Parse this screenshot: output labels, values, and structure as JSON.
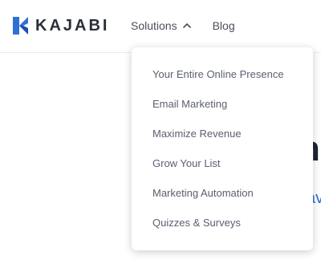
{
  "header": {
    "logo_text": "KAJABI",
    "nav": {
      "solutions_label": "Solutions",
      "blog_label": "Blog"
    }
  },
  "dropdown": {
    "items": [
      {
        "label": "Your Entire Online Presence"
      },
      {
        "label": "Email Marketing"
      },
      {
        "label": "Maximize Revenue"
      },
      {
        "label": "Grow Your List"
      },
      {
        "label": "Marketing Automation"
      },
      {
        "label": "Quizzes & Surveys"
      }
    ]
  },
  "background": {
    "heading_fragment": "n",
    "link_fragment": "av"
  },
  "colors": {
    "brand_blue": "#2f6fd6",
    "text_dark": "#2b2f3a",
    "menu_text": "#5b6070"
  },
  "icons": {
    "logo": "kajabi-logo-icon",
    "solutions_chevron": "chevron-up-icon"
  }
}
